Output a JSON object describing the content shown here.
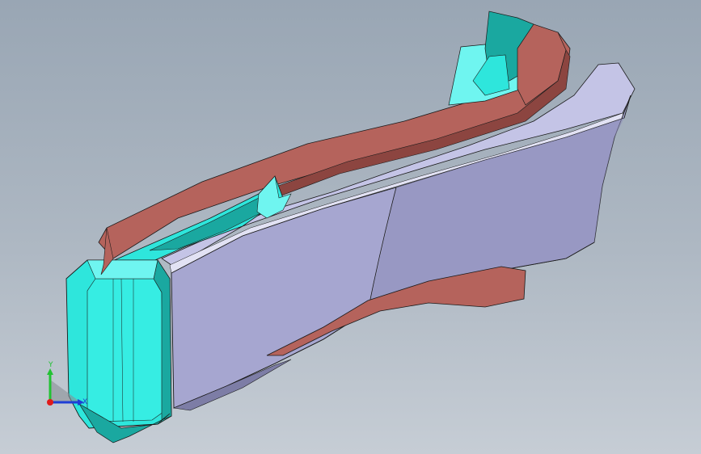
{
  "viewport": {
    "background_top": "#99a6b4",
    "background_bottom": "#c6cdd5"
  },
  "model": {
    "colors": {
      "body": "#a6a6d0",
      "body_light": "#c4c4e6",
      "body_dark": "#7d7da6",
      "flange": "#b5635c",
      "flange_dark": "#8c4540",
      "cap": "#2ee6dc",
      "cap_light": "#6ff5f0",
      "cap_dark": "#1aa8a0",
      "edge": "#1a1a1a"
    }
  },
  "triad": {
    "x_label": "X",
    "y_label": "Y",
    "x_color": "#1f3fd6",
    "y_color": "#22c233",
    "z_color": "#e01b1b"
  }
}
